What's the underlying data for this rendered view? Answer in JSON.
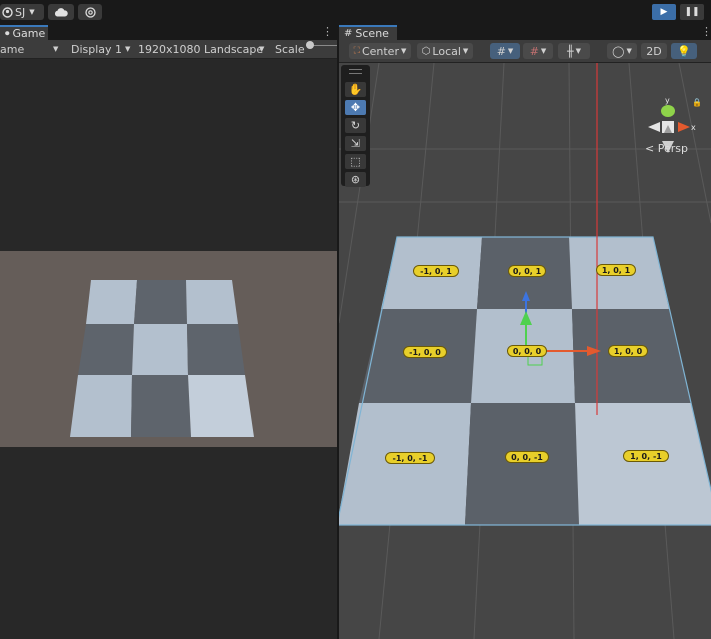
{
  "topbar": {
    "account_initials": "SJ",
    "cloud_icon": "cloud-icon",
    "collab_icon": "collab-icon",
    "play_icon": "play-icon",
    "pause_icon": "pause-icon"
  },
  "game": {
    "tab_label": "Game",
    "tab_menu": "⋮",
    "mode_label": "ame",
    "display_label": "Display 1",
    "resolution_label": "1920x1080 Landscape",
    "scale_label": "Scale"
  },
  "scene": {
    "tab_label": "Scene",
    "tab_menu": "⋮",
    "pivot_label": "Center",
    "space_label": "Local",
    "mode_2d_label": "2D",
    "persp_label": "< Persp",
    "gizmo_y": "y",
    "gizmo_x": "x",
    "tools": [
      "hand-tool",
      "move-tool",
      "rotate-tool",
      "scale-tool",
      "rect-tool",
      "transform-tool"
    ],
    "tile_labels": [
      "-1, 0, 1",
      "0, 0, 1",
      "1, 0, 1",
      "-1, 0, 0",
      "0, 0, 0",
      "1, 0, 0",
      "-1, 0, -1",
      "0, 0, -1",
      "1, 0, -1"
    ]
  },
  "colors": {
    "accent": "#3b6ea8",
    "light_tile": "#b2bfcd",
    "dark_tile": "#5b6169",
    "label_fill": "#e8cf2a",
    "game_bg": "#655d59"
  }
}
